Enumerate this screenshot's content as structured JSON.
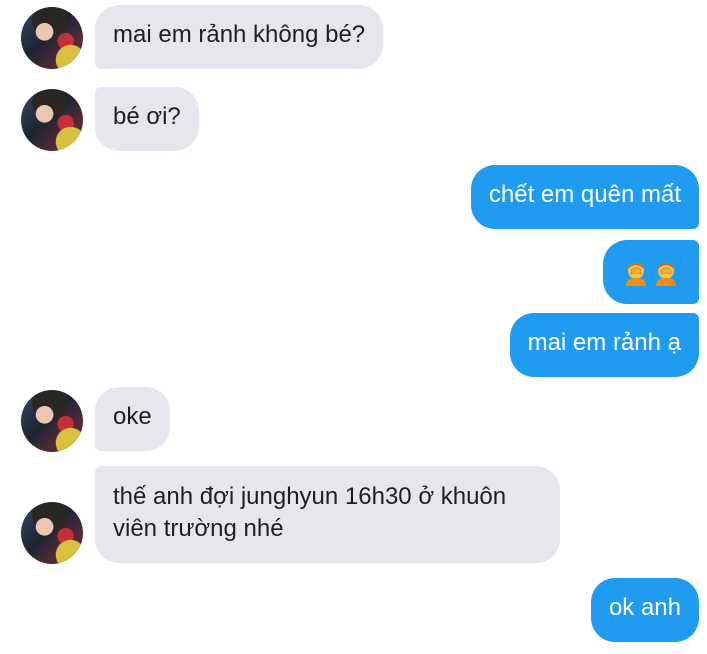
{
  "messages": [
    {
      "side": "incoming",
      "text": "mai em rảnh không bé?"
    },
    {
      "side": "incoming",
      "text": "bé ơi?"
    },
    {
      "side": "outgoing",
      "text": "chết em quên mất"
    },
    {
      "side": "outgoing",
      "emojis": [
        "face-palm-emoji",
        "face-palm-emoji"
      ]
    },
    {
      "side": "outgoing",
      "text": "mai em rảnh ạ"
    },
    {
      "side": "incoming",
      "text": "oke"
    },
    {
      "side": "incoming",
      "text": "thế anh đợi junghyun 16h30 ở khuôn viên trường nhé"
    },
    {
      "side": "outgoing",
      "text": "ok anh"
    }
  ],
  "colors": {
    "incoming_bubble": "#e4e8ed",
    "outgoing_bubble": "#1f9cf0"
  }
}
